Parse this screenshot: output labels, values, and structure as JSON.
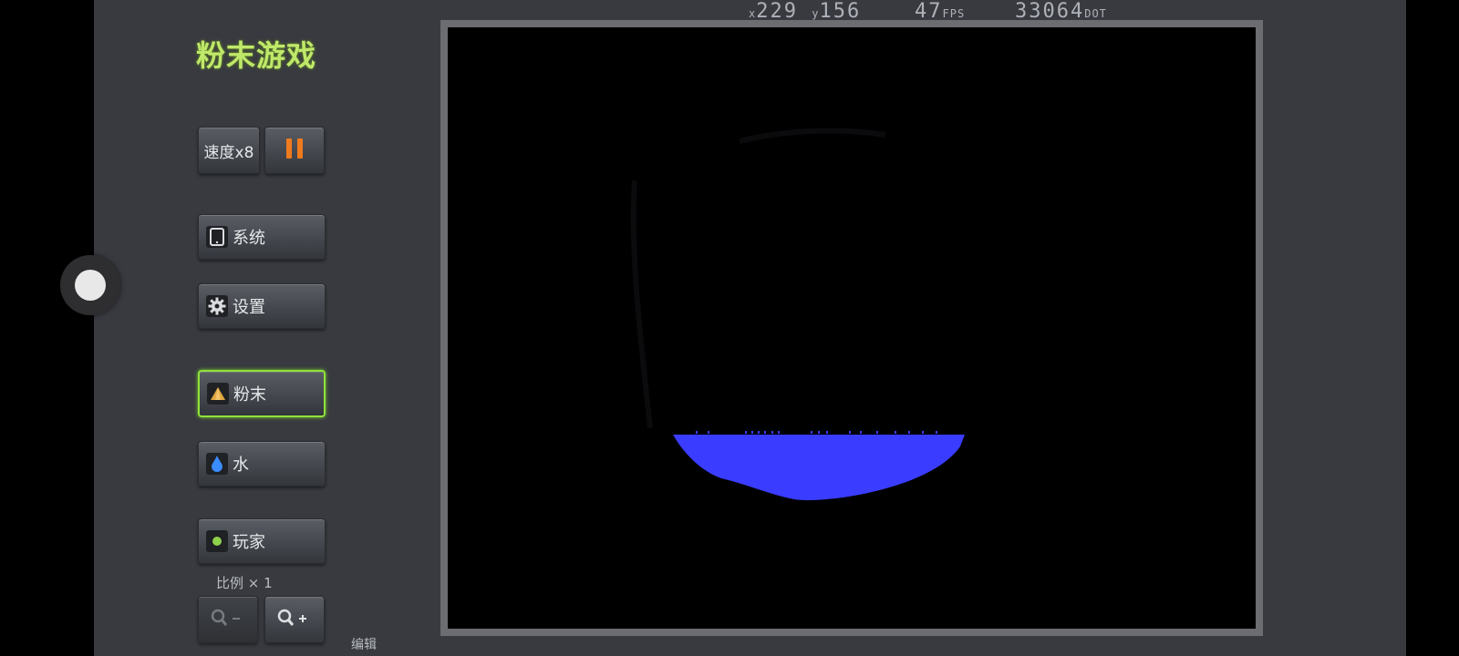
{
  "hud": {
    "x": "229",
    "y": "156",
    "fps_value": "47",
    "fps_unit": "FPS",
    "dots_value": "33064",
    "dots_unit": "DOT",
    "x_prefix": "x",
    "y_prefix": "y"
  },
  "app_title": "粉末游戏",
  "controls": {
    "speed_label": "速度x8",
    "pause": "pause"
  },
  "menu": {
    "system_label": "系统",
    "settings_label": "设置"
  },
  "elements": [
    {
      "id": "powder",
      "label": "粉末",
      "icon": "powder-cone-icon",
      "selected": true
    },
    {
      "id": "water",
      "label": "水",
      "icon": "water-drop-icon",
      "selected": false
    },
    {
      "id": "player",
      "label": "玩家",
      "icon": "player-dot-icon",
      "selected": false
    }
  ],
  "zoom": {
    "label": "比例",
    "times_sign": "×",
    "value": "1"
  },
  "edit_label": "编辑",
  "colors": {
    "panel_bg": "#383a40",
    "water": "#3a3cff",
    "accent_green": "#8fe23a",
    "pause_orange": "#f07a1e"
  }
}
